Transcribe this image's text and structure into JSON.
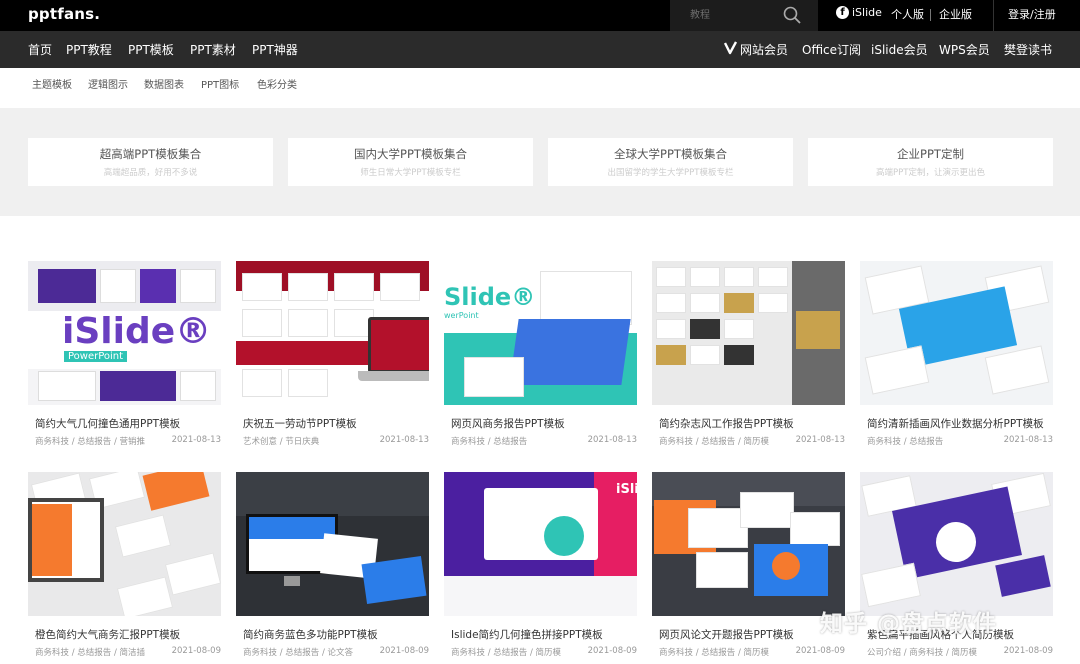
{
  "header": {
    "logo": "pptfans.",
    "search_placeholder": "教程",
    "islide_label": "iSlide",
    "personal": "个人版",
    "enterprise": "企业版",
    "login": "登录/注册"
  },
  "nav": {
    "left": [
      "首页",
      "PPT教程",
      "PPT模板",
      "PPT素材",
      "PPT神器"
    ],
    "right": [
      "网站会员",
      "Office订阅",
      "iSlide会员",
      "WPS会员",
      "樊登读书"
    ]
  },
  "subnav": [
    "主题模板",
    "逻辑图示",
    "数据图表",
    "PPT图标",
    "色彩分类"
  ],
  "features": [
    {
      "title": "超高端PPT模板集合",
      "sub": "高端超品质，好用不多说"
    },
    {
      "title": "国内大学PPT模板集合",
      "sub": "师生日常大学PPT模板专栏"
    },
    {
      "title": "全球大学PPT模板集合",
      "sub": "出国留学的学生大学PPT模板专栏"
    },
    {
      "title": "企业PPT定制",
      "sub": "高端PPT定制，让演示更出色"
    }
  ],
  "templates": [
    {
      "title": "简约大气几何撞色通用PPT模板",
      "category": "商务科技 / 总结报告 / 营销推",
      "date": "2021-08-13",
      "thumb_text": "iSlide®",
      "thumb_sub": "PowerPoint"
    },
    {
      "title": "庆祝五一劳动节PPT模板",
      "category": "艺术创意 / 节日庆典",
      "date": "2021-08-13"
    },
    {
      "title": "网页风商务报告PPT模板",
      "category": "商务科技 / 总结报告",
      "date": "2021-08-13",
      "thumb_text": "Slide®",
      "thumb_sub": "werPoint"
    },
    {
      "title": "简约杂志风工作报告PPT模板",
      "category": "商务科技 / 总结报告 / 简历模",
      "date": "2021-08-13"
    },
    {
      "title": "简约清新插画风作业数据分析PPT模板",
      "category": "商务科技 / 总结报告",
      "date": "2021-08-13"
    },
    {
      "title": "橙色简约大气商务汇报PPT模板",
      "category": "商务科技 / 总结报告 / 简洁插",
      "date": "2021-08-09"
    },
    {
      "title": "简约商务蓝色多功能PPT模板",
      "category": "商务科技 / 总结报告 / 论文答",
      "date": "2021-08-09"
    },
    {
      "title": "Islide简约几何撞色拼接PPT模板",
      "category": "商务科技 / 总结报告 / 简历模",
      "date": "2021-08-09",
      "thumb_text": "iSli"
    },
    {
      "title": "网页风论文开题报告PPT模板",
      "category": "商务科技 / 总结报告 / 简历模",
      "date": "2021-08-09"
    },
    {
      "title": "紫色扁平插画风格个人简历模板",
      "category": "公司介绍 / 商务科技 / 简历模",
      "date": "2021-08-09"
    }
  ],
  "watermark": "知乎 @盘点软件",
  "colors": {
    "topbar": "#000000",
    "navbar": "#2b2b2b",
    "accent_purple": "#5b2fa8",
    "accent_teal": "#2fc4b5",
    "accent_red": "#b3112b",
    "accent_orange": "#f57a2e",
    "accent_blue": "#3a73e0"
  }
}
